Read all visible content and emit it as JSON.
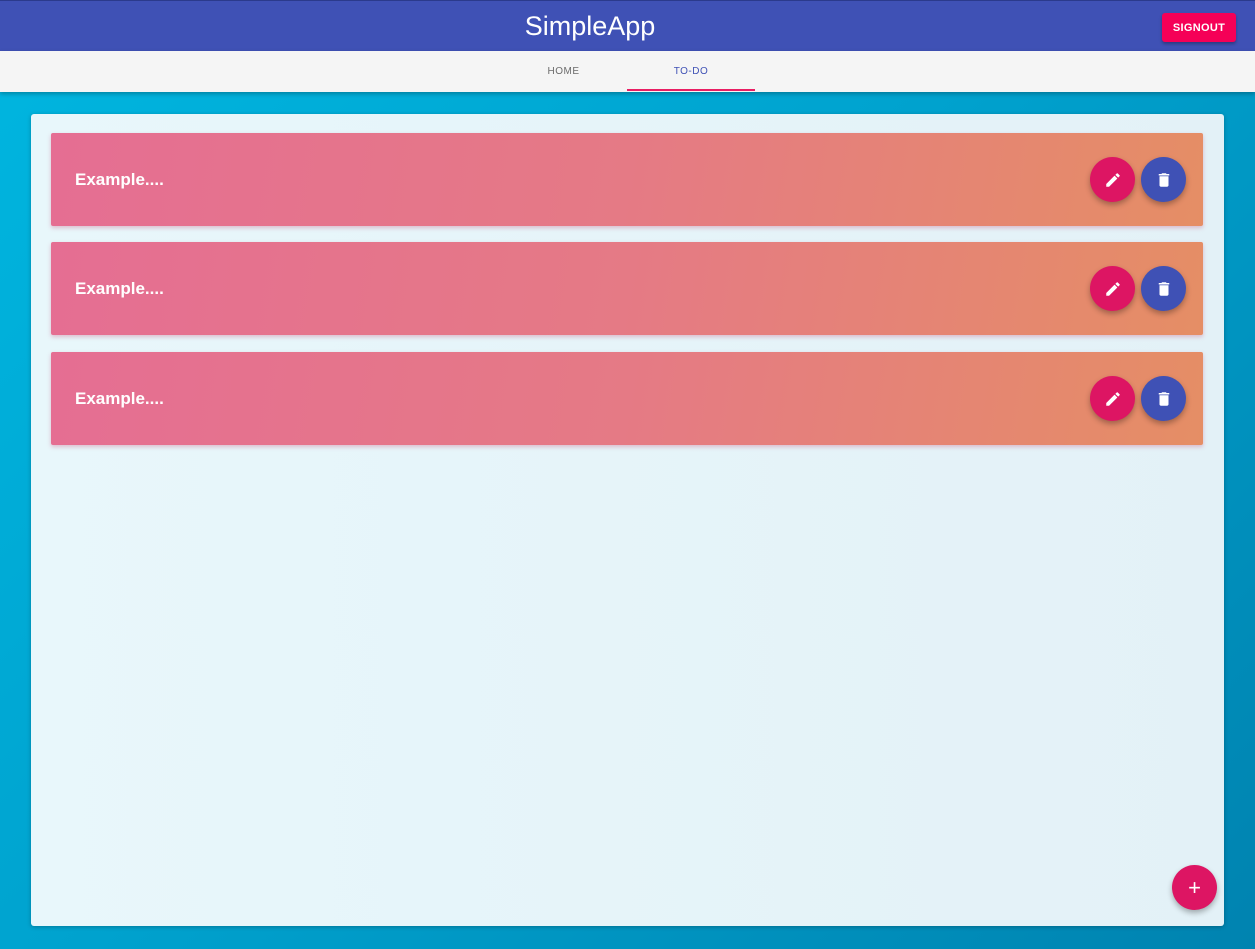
{
  "header": {
    "title": "SimpleApp",
    "signout_label": "SIGNOUT",
    "color": "#3f51b5",
    "signout_color": "#f50057"
  },
  "tabs": [
    {
      "label": "HOME",
      "active": false
    },
    {
      "label": "TO-DO",
      "active": true
    }
  ],
  "todos": [
    {
      "text": "Example....",
      "edit_icon": "pencil-icon",
      "delete_icon": "trash-icon"
    },
    {
      "text": "Example....",
      "edit_icon": "pencil-icon",
      "delete_icon": "trash-icon"
    },
    {
      "text": "Example....",
      "edit_icon": "pencil-icon",
      "delete_icon": "trash-icon"
    }
  ],
  "add_button": {
    "label": "+",
    "icon": "plus-icon"
  },
  "colors": {
    "accent": "#e91e63",
    "edit_button": "#dd1563",
    "delete_button": "#3f51b5",
    "card_gradient_start": "#e56e93",
    "card_gradient_end": "#e58e65"
  }
}
